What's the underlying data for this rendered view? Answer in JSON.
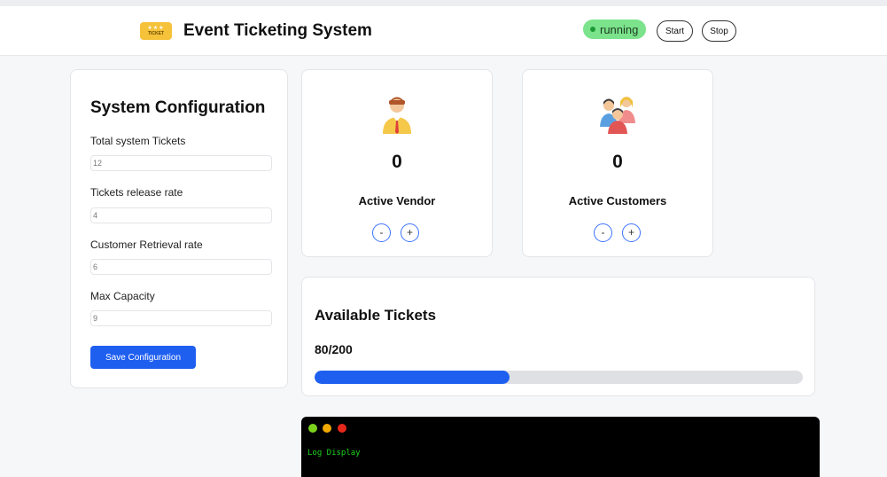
{
  "header": {
    "title": "Event Ticketing System",
    "logo_text": "TICKET",
    "logo_stars": "★★★",
    "status": "running",
    "start_label": "Start",
    "stop_label": "Stop",
    "status_color": "#7be38b"
  },
  "config": {
    "title": "System Configuration",
    "fields": [
      {
        "label": "Total system Tickets",
        "value": "12"
      },
      {
        "label": "Tickets release rate",
        "value": "4"
      },
      {
        "label": "Customer Retrieval rate",
        "value": "6"
      },
      {
        "label": "Max Capacity",
        "value": "9"
      }
    ],
    "save_label": "Save Configuration"
  },
  "vendor": {
    "count": "0",
    "label": "Active Vendor",
    "minus": "-",
    "plus": "+",
    "icon": "businessman-icon"
  },
  "customers": {
    "count": "0",
    "label": "Active Customers",
    "minus": "-",
    "plus": "+",
    "icon": "group-icon"
  },
  "tickets": {
    "title": "Available Tickets",
    "count_text": "80/200",
    "available": 80,
    "total": 200
  },
  "log": {
    "text": "Log Display"
  },
  "colors": {
    "accent": "#1f5ff0",
    "log_text": "#1ed61e"
  }
}
